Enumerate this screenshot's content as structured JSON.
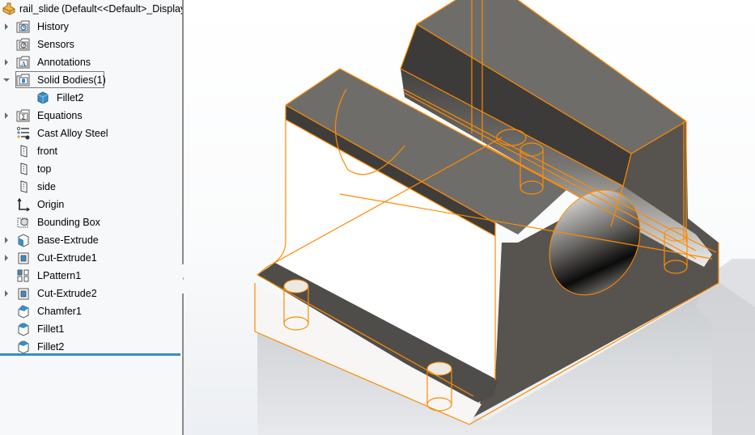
{
  "app": {
    "part_name": "rail_slide",
    "configuration": "(Default<<Default>_Display"
  },
  "feature_tree": {
    "items": [
      {
        "label": "History",
        "icon": "history-folder-icon",
        "expandable": true,
        "expanded": false,
        "indent": 0
      },
      {
        "label": "Sensors",
        "icon": "sensors-folder-icon",
        "expandable": false,
        "indent": 0
      },
      {
        "label": "Annotations",
        "icon": "annotations-folder-icon",
        "expandable": true,
        "expanded": false,
        "indent": 0
      },
      {
        "label": "Solid Bodies(1)",
        "icon": "solid-bodies-folder-icon",
        "expandable": true,
        "expanded": true,
        "indent": 0,
        "selected": true
      },
      {
        "label": "Fillet2",
        "icon": "solid-body-icon",
        "expandable": false,
        "indent": 1
      },
      {
        "label": "Equations",
        "icon": "equations-folder-icon",
        "expandable": true,
        "expanded": false,
        "indent": 0
      },
      {
        "label": "Cast Alloy Steel",
        "icon": "material-icon",
        "expandable": false,
        "indent": 0
      },
      {
        "label": "front",
        "icon": "plane-icon",
        "expandable": false,
        "indent": 0
      },
      {
        "label": "top",
        "icon": "plane-icon",
        "expandable": false,
        "indent": 0
      },
      {
        "label": "side",
        "icon": "plane-icon",
        "expandable": false,
        "indent": 0
      },
      {
        "label": "Origin",
        "icon": "origin-icon",
        "expandable": false,
        "indent": 0
      },
      {
        "label": "Bounding Box",
        "icon": "bounding-box-icon",
        "expandable": false,
        "indent": 0
      },
      {
        "label": "Base-Extrude",
        "icon": "extrude-icon",
        "expandable": true,
        "expanded": false,
        "indent": 0
      },
      {
        "label": "Cut-Extrude1",
        "icon": "cut-extrude-icon",
        "expandable": true,
        "expanded": false,
        "indent": 0
      },
      {
        "label": "LPattern1",
        "icon": "linear-pattern-icon",
        "expandable": false,
        "indent": 0
      },
      {
        "label": "Cut-Extrude2",
        "icon": "cut-extrude-icon",
        "expandable": true,
        "expanded": false,
        "indent": 0
      },
      {
        "label": "Chamfer1",
        "icon": "chamfer-icon",
        "expandable": false,
        "indent": 0
      },
      {
        "label": "Fillet1",
        "icon": "fillet-icon",
        "expandable": false,
        "indent": 0
      },
      {
        "label": "Fillet2",
        "icon": "fillet-icon",
        "expandable": false,
        "indent": 0
      }
    ]
  },
  "colors": {
    "highlight_edges": "#ff8a00",
    "rollback_bar": "#3a8dc9",
    "body_dark": "#4a4846",
    "body_top": "#6e6c69"
  },
  "viewport": {
    "model_name": "rail_slide",
    "material": "Cast Alloy Steel"
  }
}
